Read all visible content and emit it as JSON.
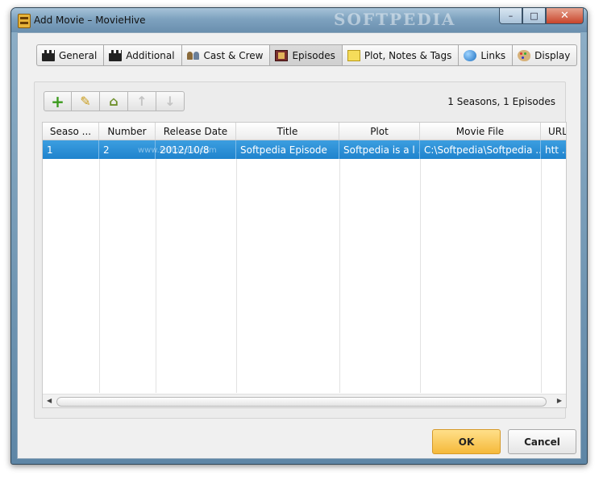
{
  "window": {
    "title": "Add Movie – MovieHive",
    "watermark": "SOFTPEDIA",
    "controls": {
      "minimize": "–",
      "maximize": "□",
      "close": "✕"
    }
  },
  "tabs": [
    {
      "label": "General",
      "icon": "clapperboard-icon"
    },
    {
      "label": "Additional",
      "icon": "clapperboard-icon"
    },
    {
      "label": "Cast & Crew",
      "icon": "people-icon"
    },
    {
      "label": "Episodes",
      "icon": "film-icon",
      "active": true
    },
    {
      "label": "Plot, Notes & Tags",
      "icon": "note-icon"
    },
    {
      "label": "Links",
      "icon": "globe-icon"
    },
    {
      "label": "Display",
      "icon": "palette-icon"
    }
  ],
  "toolbar": {
    "add": "+",
    "edit": "✎",
    "delete": "⌂",
    "up": "↑",
    "down": "↓"
  },
  "summary": "1 Seasons, 1 Episodes",
  "table": {
    "headers": [
      "Seaso ...",
      "Number",
      "Release Date",
      "Title",
      "Plot",
      "Movie File",
      "URL"
    ],
    "rows": [
      [
        "1",
        "2",
        "2012/10/8",
        "Softpedia Episode",
        "Softpedia is a l ...",
        "C:\\Softpedia\\Softpedia  ...",
        "htt ..."
      ]
    ],
    "watermark": "www.softpedia.com"
  },
  "scrollbar": {
    "left": "◀",
    "right": "▶"
  },
  "buttons": {
    "ok": "OK",
    "cancel": "Cancel"
  },
  "colors": {
    "accent": "#1f83cd",
    "ok_button": "#f5b93a"
  }
}
